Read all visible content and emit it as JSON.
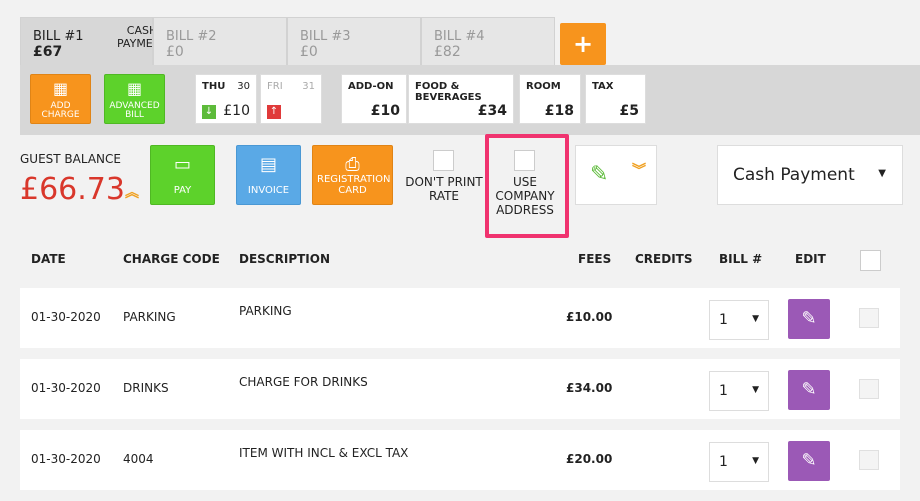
{
  "bills": [
    {
      "label": "BILL #1",
      "amount": "£67",
      "extra": "CASH PAYMENT"
    },
    {
      "label": "BILL #2",
      "amount": "£0"
    },
    {
      "label": "BILL #3",
      "amount": "£0"
    },
    {
      "label": "BILL #4",
      "amount": "£82"
    }
  ],
  "add_bill_symbol": "+",
  "toolbar": {
    "add_charge": "ADD CHARGE",
    "advanced_bill": "ADVANCED BILL",
    "days": [
      {
        "name": "THU",
        "date": "30",
        "amount": "£10",
        "arrow": "↓"
      },
      {
        "name": "FRI",
        "date": "31",
        "amount": "",
        "arrow": "↑"
      }
    ],
    "summaries": [
      {
        "label": "ADD-ON",
        "value": "£10"
      },
      {
        "label": "FOOD & BEVERAGES",
        "value": "£34"
      },
      {
        "label": "ROOM",
        "value": "£18"
      },
      {
        "label": "TAX",
        "value": "£5"
      }
    ]
  },
  "balance": {
    "label": "GUEST BALANCE",
    "amount": "£66.73"
  },
  "actions": {
    "pay": "PAY",
    "invoice": "INVOICE",
    "registration_card": "REGISTRATION CARD",
    "dont_print_rate": "DON'T PRINT RATE",
    "use_company_address": "USE COMPANY ADDRESS"
  },
  "payment_method": "Cash Payment",
  "table": {
    "headers": [
      "DATE",
      "CHARGE CODE",
      "DESCRIPTION",
      "FEES",
      "CREDITS",
      "BILL #",
      "EDIT"
    ],
    "rows": [
      {
        "date": "01-30-2020",
        "code": "PARKING",
        "desc": "PARKING",
        "fees": "£10.00",
        "credits": "",
        "bill": "1"
      },
      {
        "date": "01-30-2020",
        "code": "DRINKS",
        "desc": "CHARGE FOR DRINKS",
        "fees": "£34.00",
        "credits": "",
        "bill": "1"
      },
      {
        "date": "01-30-2020",
        "code": "4004",
        "desc": "ITEM WITH INCL & EXCL TAX",
        "fees": "£20.00",
        "credits": "",
        "bill": "1"
      }
    ]
  },
  "colors": {
    "accent_orange": "#f7941d",
    "green": "#5dd22b",
    "balance_red": "#d9372b",
    "highlight_pink": "#f0336f",
    "edit_purple": "#9b59b6"
  }
}
